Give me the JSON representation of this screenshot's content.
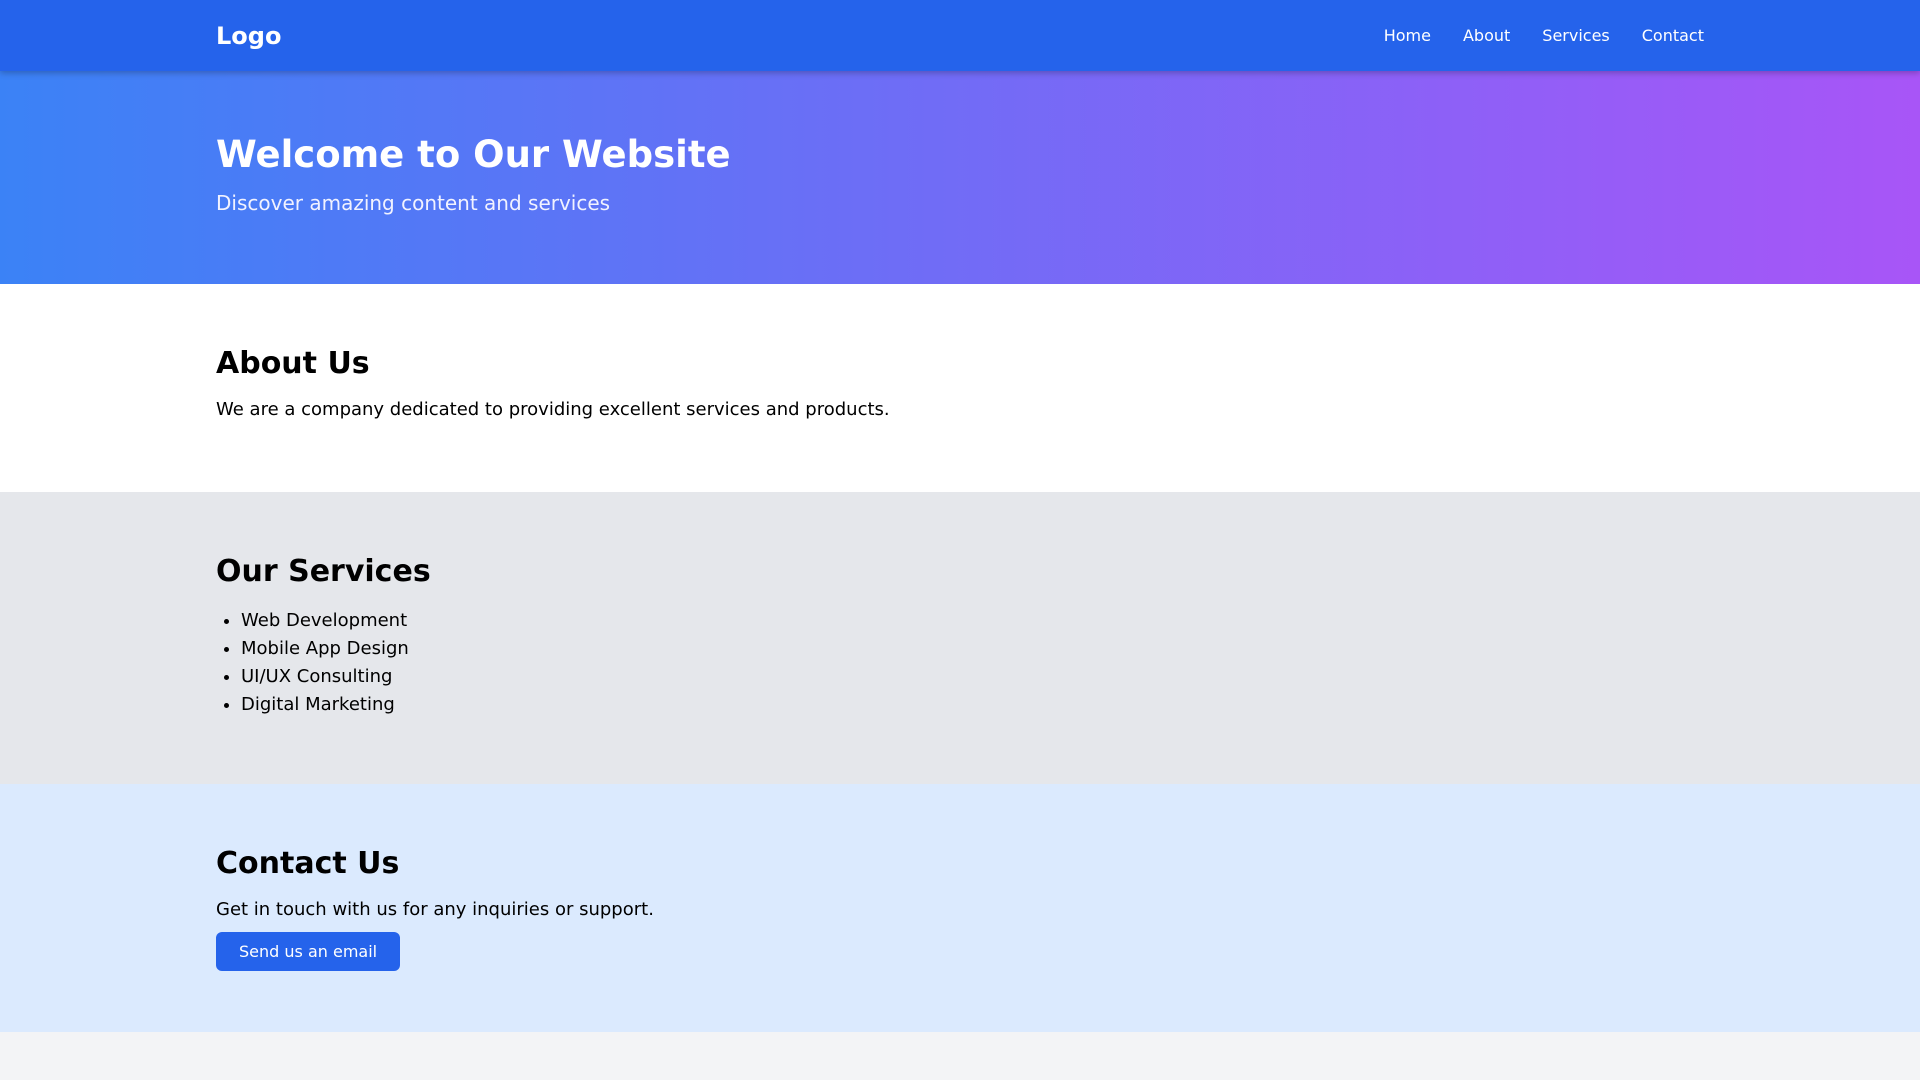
{
  "navbar": {
    "logo": "Logo",
    "links": [
      {
        "label": "Home"
      },
      {
        "label": "About"
      },
      {
        "label": "Services"
      },
      {
        "label": "Contact"
      }
    ]
  },
  "hero": {
    "title": "Welcome to Our Website",
    "subtitle": "Discover amazing content and services"
  },
  "about": {
    "heading": "About Us",
    "text": "We are a company dedicated to providing excellent services and products."
  },
  "services": {
    "heading": "Our Services",
    "items": [
      "Web Development",
      "Mobile App Design",
      "UI/UX Consulting",
      "Digital Marketing"
    ]
  },
  "contact": {
    "heading": "Contact Us",
    "text": "Get in touch with us for any inquiries or support.",
    "button_label": "Send us an email"
  },
  "colors": {
    "primary": "#2563eb",
    "hero_gradient_start": "#3b82f6",
    "hero_gradient_end": "#a855f7",
    "services_bg": "#e5e7eb",
    "contact_bg": "#dbeafe",
    "page_bg": "#f3f4f6"
  }
}
